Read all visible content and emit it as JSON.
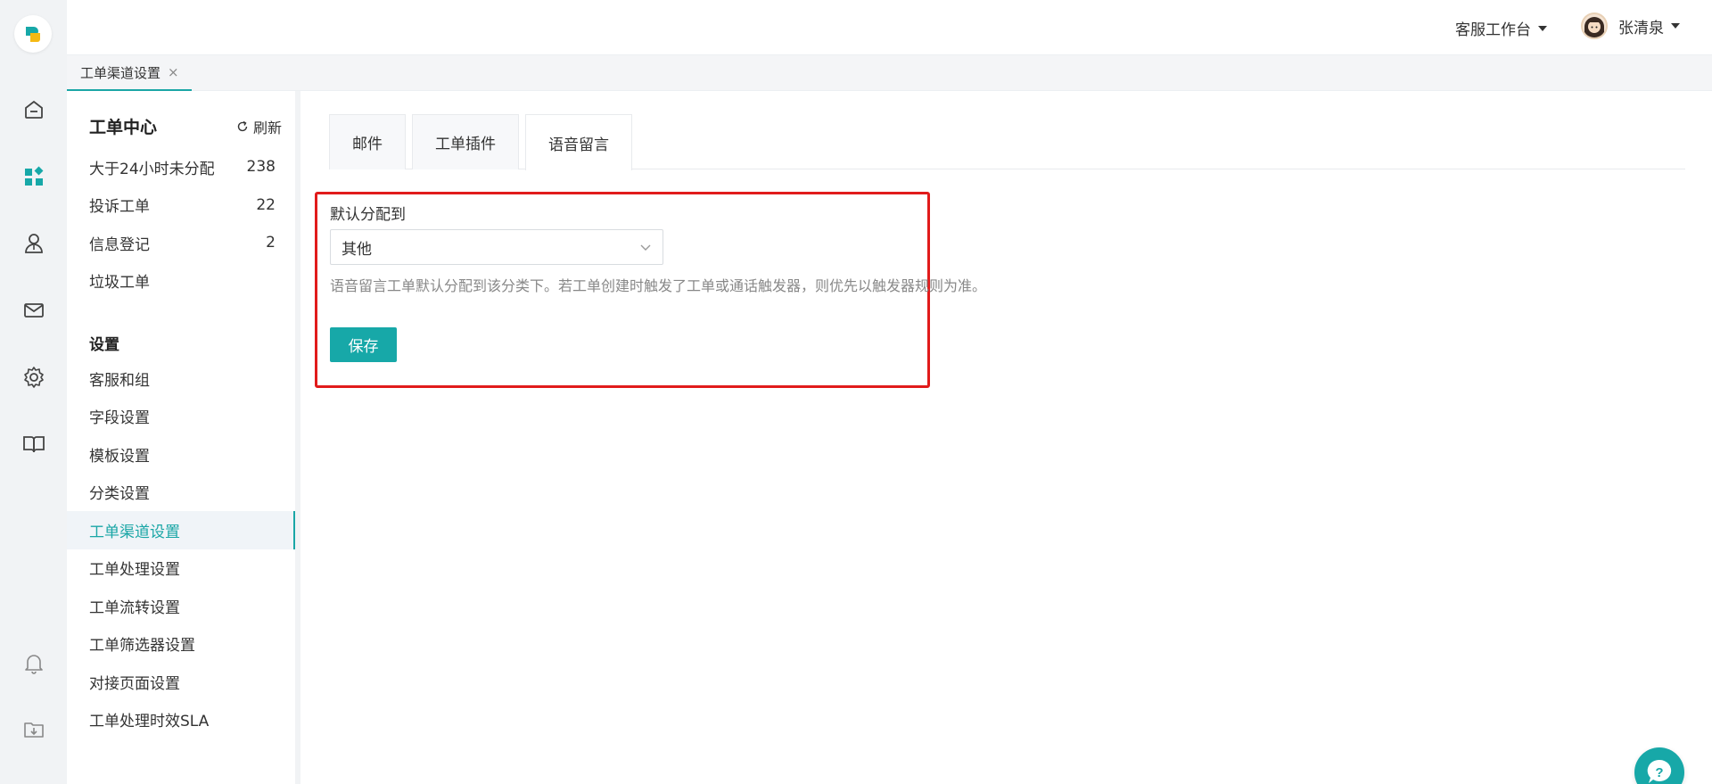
{
  "header": {
    "workbench_label": "客服工作台",
    "user_name": "张清泉"
  },
  "rail": {
    "icons": [
      "home-icon",
      "apps-icon",
      "agent-icon",
      "mail-icon",
      "gear-icon",
      "book-icon",
      "bell-icon",
      "download-folder-icon"
    ],
    "active": "apps-icon"
  },
  "page_tab": {
    "label": "工单渠道设置",
    "close": "×"
  },
  "sidebar": {
    "title": "工单中心",
    "refresh_label": "刷新",
    "queues": [
      {
        "label": "大于24小时未分配",
        "count": "238"
      },
      {
        "label": "投诉工单",
        "count": "22"
      },
      {
        "label": "信息登记",
        "count": "2"
      },
      {
        "label": "垃圾工单",
        "count": ""
      }
    ],
    "settings_title": "设置",
    "settings": [
      {
        "label": "客服和组"
      },
      {
        "label": "字段设置"
      },
      {
        "label": "模板设置"
      },
      {
        "label": "分类设置"
      },
      {
        "label": "工单渠道设置"
      },
      {
        "label": "工单处理设置"
      },
      {
        "label": "工单流转设置"
      },
      {
        "label": "工单筛选器设置"
      },
      {
        "label": "对接页面设置"
      },
      {
        "label": "工单处理时效SLA"
      }
    ],
    "active_setting": "工单渠道设置"
  },
  "content": {
    "tabs": [
      {
        "label": "邮件"
      },
      {
        "label": "工单插件"
      },
      {
        "label": "语音留言"
      }
    ],
    "active_tab": "语音留言",
    "form": {
      "label": "默认分配到",
      "selected_value": "其他",
      "hint": "语音留言工单默认分配到该分类下。若工单创建时触发了工单或通话触发器，则优先以触发器规则为准。",
      "save_label": "保存"
    }
  },
  "help": {
    "icon": "help-question-icon"
  },
  "colors": {
    "accent": "#17a8a8",
    "highlight_border": "#e11b1b",
    "rail_bg": "#f1f3f5"
  }
}
